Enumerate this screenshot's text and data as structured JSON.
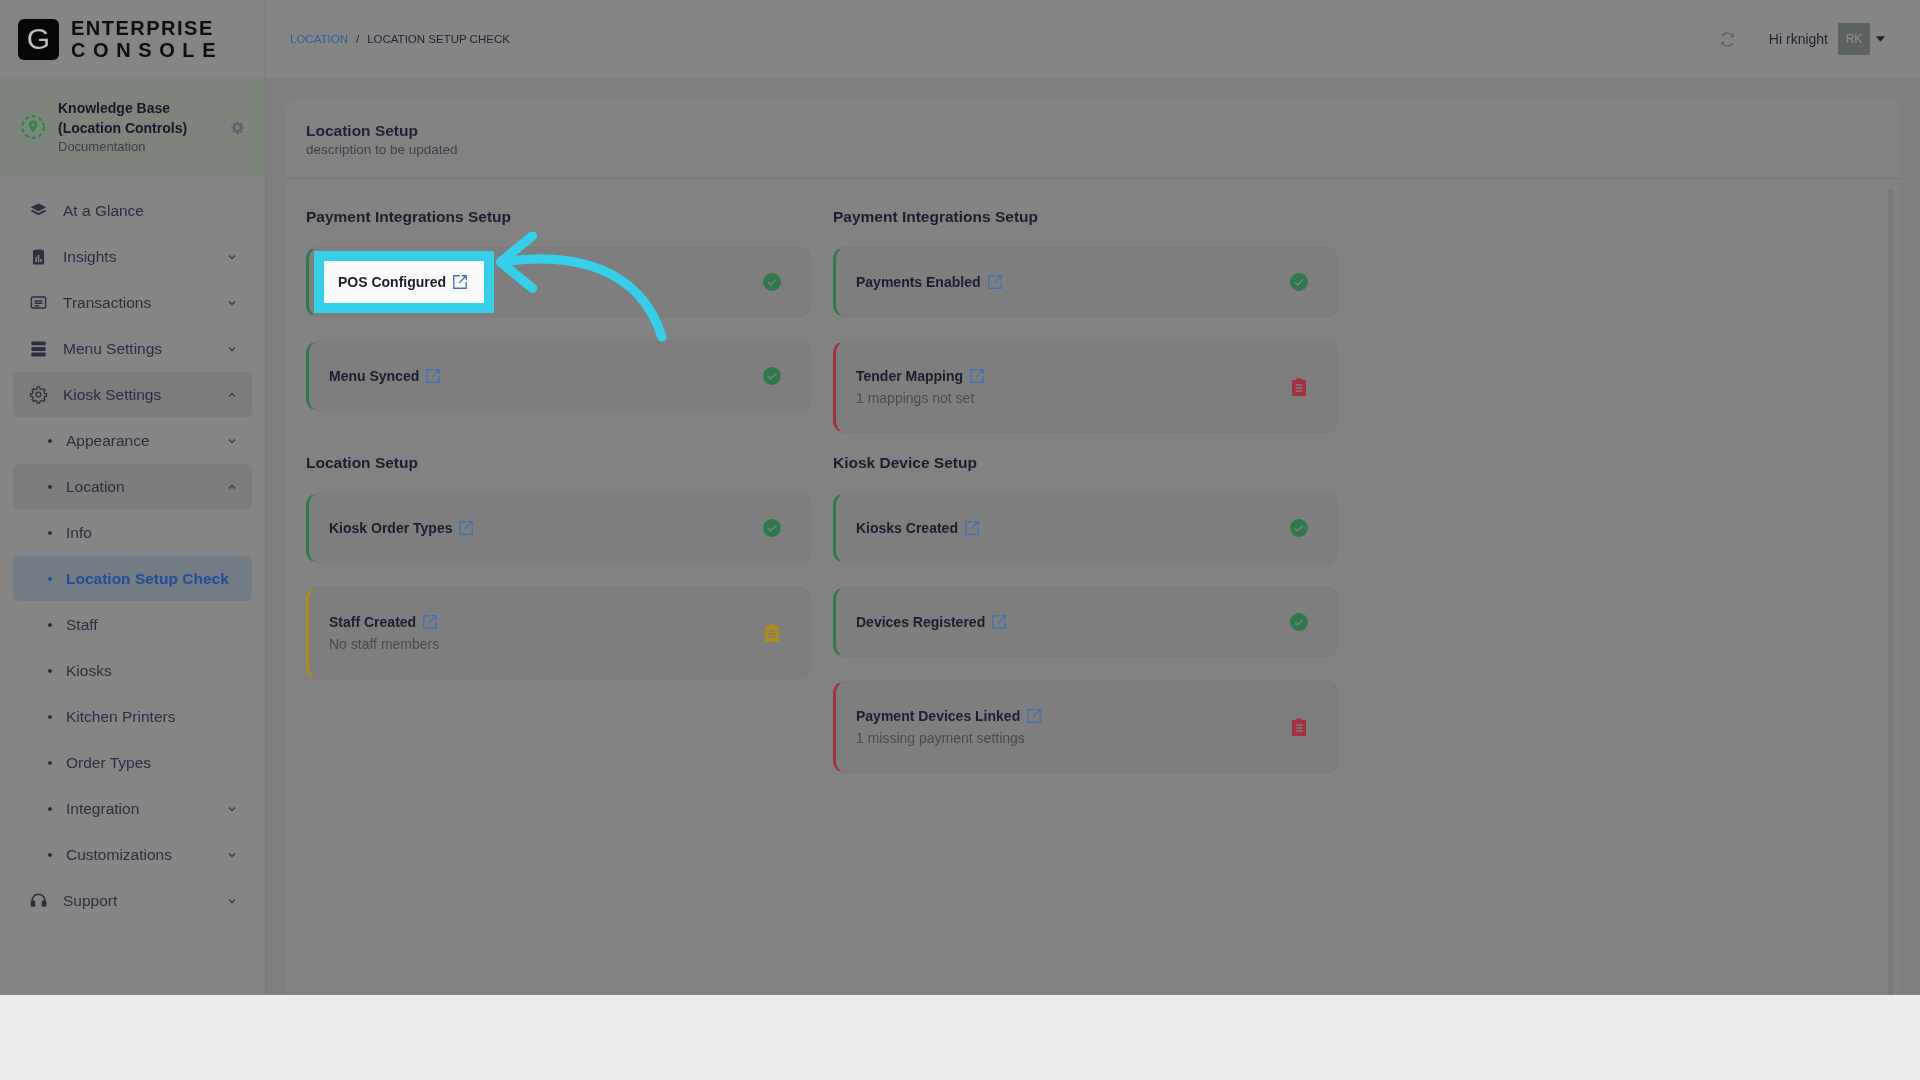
{
  "brand": {
    "logo_letter": "G",
    "line1": "ENTERPRISE",
    "line2": "CONSOLE"
  },
  "breadcrumb": {
    "items": [
      {
        "label": "LOCATION",
        "link": true
      },
      {
        "label": "LOCATION SETUP CHECK",
        "link": false
      }
    ],
    "separator": "/"
  },
  "user": {
    "greeting": "Hi rknight",
    "initials": "RK"
  },
  "workspace": {
    "name": "Knowledge Base (Location Controls)",
    "subtitle": "Documentation"
  },
  "sidebar": {
    "items": [
      {
        "label": "At a Glance",
        "selected": false
      },
      {
        "label": "Insights",
        "selected": false,
        "expanded": false
      },
      {
        "label": "Transactions",
        "selected": false,
        "expanded": false
      },
      {
        "label": "Menu Settings",
        "selected": false,
        "expanded": false
      },
      {
        "label": "Kiosk Settings",
        "selected": false,
        "expanded": true,
        "children": [
          {
            "label": "Appearance",
            "selected": false,
            "expanded": false
          },
          {
            "label": "Location",
            "selected": false,
            "expanded": true
          },
          {
            "label": "Info",
            "selected": false
          },
          {
            "label": "Location Setup Check",
            "selected": true
          },
          {
            "label": "Staff",
            "selected": false
          },
          {
            "label": "Kiosks",
            "selected": false
          },
          {
            "label": "Kitchen Printers",
            "selected": false
          },
          {
            "label": "Order Types",
            "selected": false
          },
          {
            "label": "Integration",
            "selected": false,
            "expanded": false
          },
          {
            "label": "Customizations",
            "selected": false,
            "expanded": false
          }
        ]
      },
      {
        "label": "Support",
        "selected": false,
        "expanded": false
      }
    ]
  },
  "panel": {
    "title": "Location Setup",
    "description": "description to be updated",
    "sections": [
      {
        "title": "Payment Integrations Setup",
        "items": [
          {
            "label": "POS Configured",
            "kind": "done",
            "highlighted": true
          },
          {
            "label": "Menu Synced",
            "kind": "done",
            "highlighted": false
          }
        ]
      },
      {
        "title": "Payment Integrations Setup",
        "items": [
          {
            "label": "Payments Enabled",
            "kind": "done",
            "highlighted": false
          },
          {
            "label": "Tender Mapping",
            "kind": "error",
            "note": "1 mappings not set",
            "highlighted": false
          }
        ]
      },
      {
        "title": "Location Setup",
        "items": [
          {
            "label": "Kiosk Order Types",
            "kind": "done",
            "highlighted": false
          },
          {
            "label": "Staff Created",
            "kind": "warning",
            "note": "No staff members",
            "highlighted": false
          }
        ]
      },
      {
        "title": "Kiosk Device Setup",
        "items": [
          {
            "label": "Kiosks Created",
            "kind": "done",
            "highlighted": false
          },
          {
            "label": "Devices Registered",
            "kind": "done",
            "highlighted": false
          },
          {
            "label": "Payment Devices Linked",
            "kind": "error",
            "note": "1 missing payment settings",
            "highlighted": false
          }
        ]
      }
    ]
  }
}
